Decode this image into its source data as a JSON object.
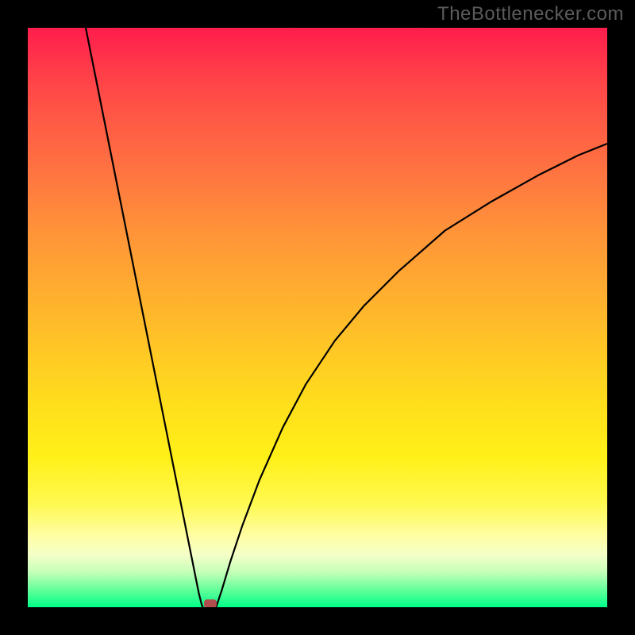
{
  "watermark": "TheBottlenecker.com",
  "chart_data": {
    "type": "line",
    "title": "",
    "xlabel": "",
    "ylabel": "",
    "xlim": [
      0,
      100
    ],
    "ylim": [
      0,
      100
    ],
    "grid": false,
    "legend": false,
    "background": "heatmap-gradient",
    "gradient_colors_top_to_bottom": [
      "#ff1d4d",
      "#ff5a45",
      "#ff9339",
      "#ffc626",
      "#fff018",
      "#fffea8",
      "#c4ffb8",
      "#00ff88"
    ],
    "series": [
      {
        "name": "bottleneck-left",
        "x": [
          10.0,
          12.5,
          15.0,
          17.5,
          20.0,
          22.5,
          25.0,
          27.0,
          28.5,
          29.5,
          30.0,
          30.2
        ],
        "values": [
          100.0,
          87.5,
          75.0,
          62.5,
          50.0,
          37.5,
          25.0,
          15.0,
          7.5,
          2.5,
          0.5,
          0.0
        ]
      },
      {
        "name": "bottleneck-right",
        "x": [
          32.5,
          33.5,
          35.0,
          37.0,
          40.0,
          44.0,
          48.0,
          53.0,
          58.0,
          64.0,
          72.0,
          80.0,
          88.0,
          95.0,
          100.0
        ],
        "values": [
          0.0,
          3.0,
          8.0,
          14.0,
          22.0,
          31.0,
          38.5,
          46.0,
          52.0,
          58.0,
          65.0,
          70.0,
          74.5,
          78.0,
          80.0
        ]
      }
    ],
    "annotations": [
      {
        "name": "optimum-marker",
        "x": 31.5,
        "y": 0.6,
        "shape": "rounded-rect",
        "color": "#b24d4d"
      }
    ]
  }
}
